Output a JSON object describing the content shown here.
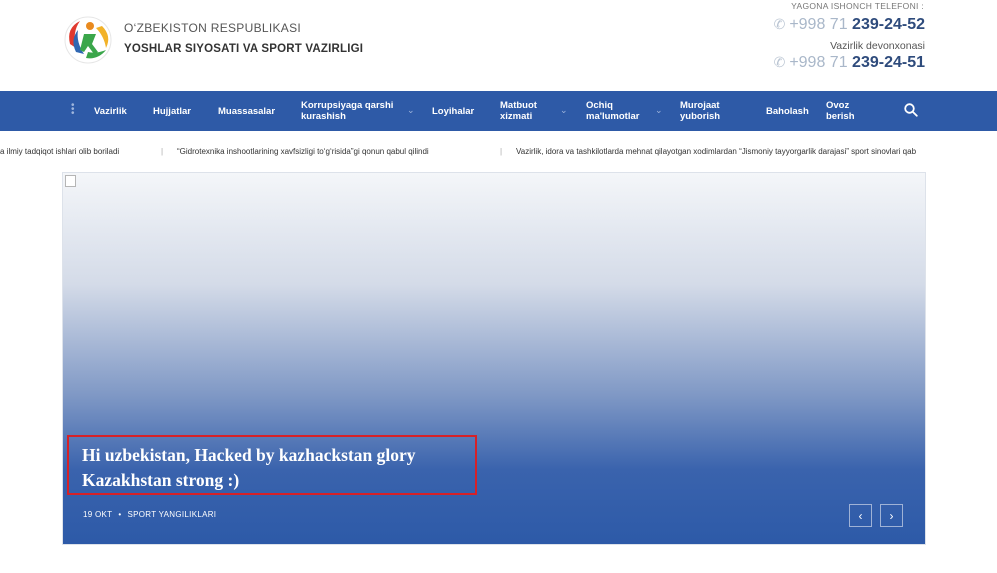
{
  "header": {
    "org_top": "O‘ZBEKISTON RESPUBLIKASI",
    "org_main": "YOSHLAR SIYOSATI VA SPORT VAZIRLIGI",
    "hotline_label": "YAGONA ISHONCH TELEFONI :",
    "phone1_code": "+998 71",
    "phone1_number": "239-24-52",
    "ministry_label": "Vazirlik devonxonasi",
    "phone2_code": "+998 71",
    "phone2_number": "239-24-51",
    "phone_icon": "phone-icon",
    "logo": "ministry-logo"
  },
  "nav": {
    "menu_icon": "vertical-dots-icon",
    "items": [
      {
        "label": "Vazirlik"
      },
      {
        "label": "Hujjatlar"
      },
      {
        "label": "Muassasalar"
      },
      {
        "label": "Korrupsiyaga qarshi kurashish"
      },
      {
        "label": "Loyihalar"
      },
      {
        "label": "Matbuot xizmati"
      },
      {
        "label": "Ochiq ma'lumotlar"
      },
      {
        "label": "Murojaat yuborish"
      },
      {
        "label": "Baholash"
      },
      {
        "label": "Ovoz berish"
      }
    ],
    "search_icon": "search-icon",
    "colors": {
      "bar": "#2e5aa7",
      "text": "#ffffff"
    }
  },
  "ticker": {
    "items": [
      "a ilmiy tadqiqot ishlari olib boriladi",
      "“Gidrotexnika inshootlarining xavfsizligi to‘g‘risida”gi qonun qabul qilindi",
      "Vazirlik, idora va tashkilotlarda mehnat qilayotgan xodimlardan “Jismoniy tayyorgarlik darajasi” sport sinovlari qab"
    ],
    "separator": "|"
  },
  "slider": {
    "headline": "Hi uzbekistan, Hacked by kazhackstan glory Kazakhstan strong :)",
    "date": "19 OKT",
    "dot": "•",
    "category": "SPORT YANGILIKLARI",
    "prev_icon": "chevron-left-icon",
    "next_icon": "chevron-right-icon",
    "prev_glyph": "‹",
    "next_glyph": "›",
    "highlight_color": "#d62128"
  }
}
